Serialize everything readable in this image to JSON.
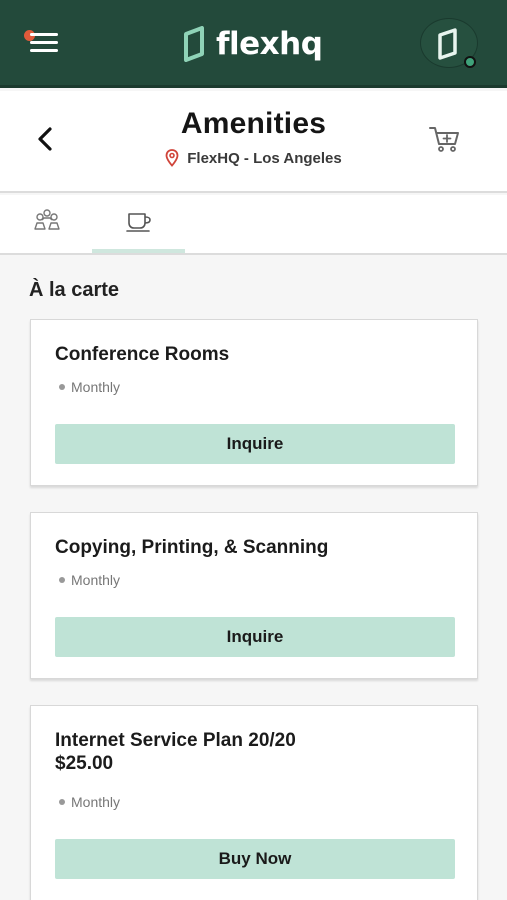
{
  "app": {
    "brand": "flexhq",
    "colors": {
      "header_bg": "#234a3b",
      "button_bg": "#bfe3d6",
      "notification": "#e05a3a",
      "status_online": "#3fa27a"
    },
    "icons": [
      "menu-icon",
      "logo-icon",
      "avatar-icon",
      "back-icon",
      "location-pin-icon",
      "cart-icon",
      "people-icon",
      "coffee-cup-icon"
    ]
  },
  "header": {
    "title": "Amenities",
    "location": "FlexHQ - Los Angeles"
  },
  "tabs": [
    {
      "icon": "people-icon",
      "selected": false
    },
    {
      "icon": "coffee-cup-icon",
      "selected": true
    }
  ],
  "section": {
    "title": "À la carte"
  },
  "items": [
    {
      "name": "Conference Rooms",
      "price": "",
      "frequency": "Monthly",
      "action": "Inquire"
    },
    {
      "name": "Copying, Printing, & Scanning",
      "price": "",
      "frequency": "Monthly",
      "action": "Inquire"
    },
    {
      "name": "Internet Service Plan 20/20",
      "price": "$25.00",
      "frequency": "Monthly",
      "action": "Buy Now"
    }
  ]
}
